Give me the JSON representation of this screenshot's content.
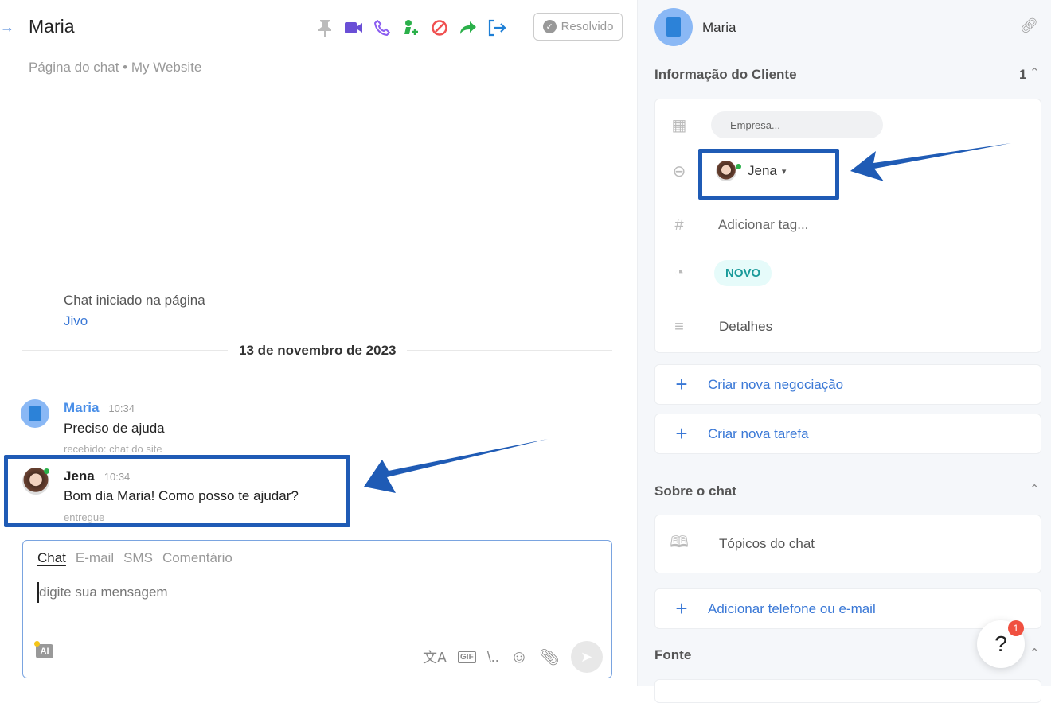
{
  "header": {
    "title": "Maria",
    "subtitle": "Página do chat • My Website",
    "resolve_label": "Resolvido",
    "actions": [
      "pin-icon",
      "video-icon",
      "phone-icon",
      "add-user-icon",
      "block-icon",
      "forward-icon",
      "exit-icon"
    ]
  },
  "chat": {
    "system_text": "Chat iniciado na página",
    "system_link": "Jivo",
    "date": "13 de novembro de 2023",
    "messages": [
      {
        "author": "Maria",
        "time": "10:34",
        "text": "Preciso de ajuda",
        "status": "recebido: chat do site"
      },
      {
        "author": "Jena",
        "time": "10:34",
        "text": "Bom dia Maria! Como posso te ajudar?",
        "status": "entregue"
      }
    ]
  },
  "composer": {
    "tabs": [
      "Chat",
      "E-mail",
      "SMS",
      "Comentário"
    ],
    "placeholder": "digite sua mensagem",
    "ai_label": "AI",
    "gif_label": "GIF"
  },
  "sidebar": {
    "name": "Maria",
    "client_info": {
      "title": "Informação do Cliente",
      "count": "1",
      "company_placeholder": "Empresa...",
      "agent": "Jena",
      "tag_placeholder": "Adicionar tag...",
      "status": "NOVO",
      "details": "Detalhes"
    },
    "new_deal": "Criar nova negociação",
    "new_task": "Criar nova tarefa",
    "about": {
      "title": "Sobre o chat",
      "topics": "Tópicos do chat"
    },
    "add_contact": "Adicionar telefone ou e-mail",
    "source": {
      "title": "Fonte"
    }
  },
  "help": {
    "label": "?",
    "badge": "1"
  },
  "colors": {
    "accent": "#3a78d6",
    "highlight": "#1f5bb5",
    "status_bg": "#e6fbfa",
    "status_text": "#1a9a9a"
  }
}
